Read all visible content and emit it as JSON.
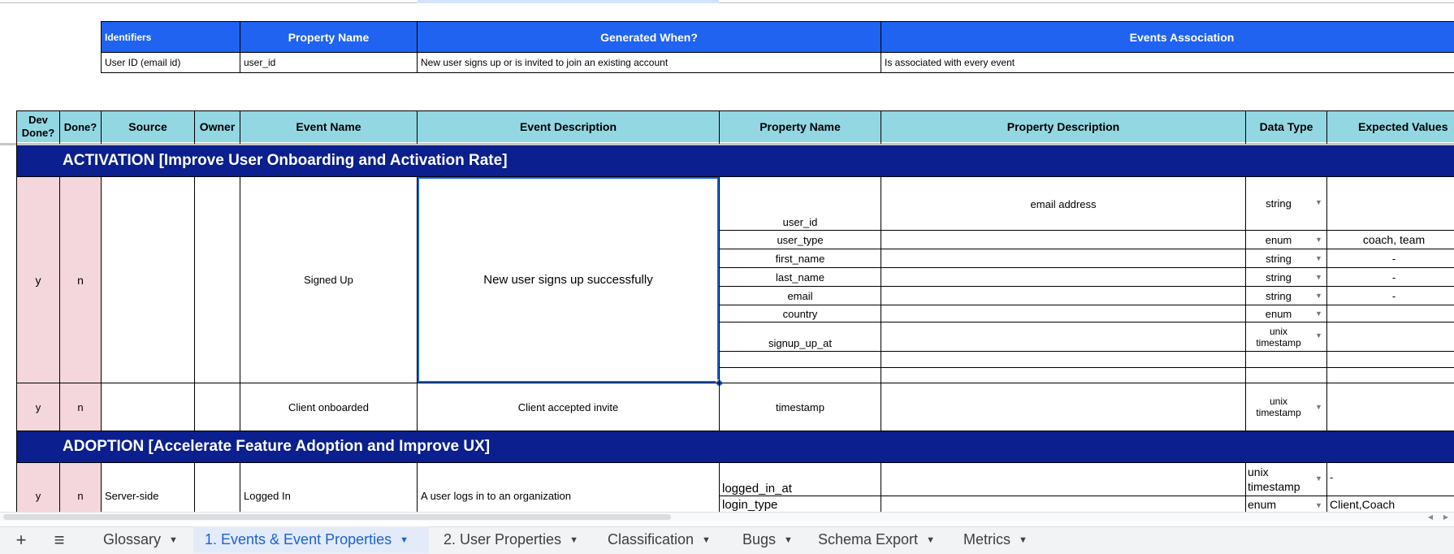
{
  "id_table": {
    "headers": [
      "Identifiers",
      "Property Name",
      "Generated When?",
      "Events Association"
    ],
    "row": [
      "User ID (email id)",
      "user_id",
      "New user signs up or is invited to join an existing account",
      "Is associated with every event"
    ]
  },
  "events_table": {
    "headers": {
      "dev_done": "Dev\nDone?",
      "done": "Done?",
      "source": "Source",
      "owner": "Owner",
      "event_name": "Event Name",
      "event_description": "Event Description",
      "property_name": "Property Name",
      "property_description": "Property Description",
      "data_type": "Data Type",
      "expected_values": "Expected Values"
    },
    "sections": [
      "ACTIVATION [Improve User Onboarding and Activation Rate]",
      "ADOPTION [Accelerate Feature Adoption and Improve UX]"
    ],
    "signed_up": {
      "dev_done": "y",
      "done": "n",
      "event_name": "Signed Up",
      "event_description": "New user signs up successfully",
      "properties": [
        {
          "name": "user_id",
          "description": "email address",
          "type": "string",
          "expected": ""
        },
        {
          "name": "user_type",
          "description": "",
          "type": "enum",
          "expected": "coach, team"
        },
        {
          "name": "first_name",
          "description": "",
          "type": "string",
          "expected": "-"
        },
        {
          "name": "last_name",
          "description": "",
          "type": "string",
          "expected": "-"
        },
        {
          "name": "email",
          "description": "",
          "type": "string",
          "expected": "-"
        },
        {
          "name": "country",
          "description": "",
          "type": "enum",
          "expected": ""
        },
        {
          "name": "signup_up_at",
          "description": "",
          "type": "unix\ntimestamp",
          "expected": ""
        }
      ]
    },
    "client_onboarded": {
      "dev_done": "y",
      "done": "n",
      "event_name": "Client onboarded",
      "event_description": "Client accepted invite",
      "property_name": "timestamp",
      "type": "unix\ntimestamp"
    },
    "logged_in": {
      "dev_done": "y",
      "done": "n",
      "source": "Server-side",
      "event_name": "Logged In",
      "event_description": "A user logs in to an organization",
      "properties": [
        {
          "name": "logged_in_at",
          "type": "unix\ntimestamp",
          "expected": "-"
        },
        {
          "name": "login_type",
          "type": "enum",
          "expected": "Client,Coach"
        }
      ]
    }
  },
  "sheet_tabs": {
    "add_icon": "+",
    "menu_icon": "≡",
    "tabs": [
      "Glossary",
      "1. Events & Event Properties",
      "2. User Properties",
      "Classification",
      "Bugs",
      "Schema Export",
      "Metrics"
    ],
    "active": "1. Events & Event Properties"
  },
  "colors": {
    "blue_header": "#1f63f0",
    "cyan_header": "#93d7e2",
    "section_band": "#0b1f8e",
    "pink": "#f4d7dc",
    "selection": "#1a62d6"
  }
}
